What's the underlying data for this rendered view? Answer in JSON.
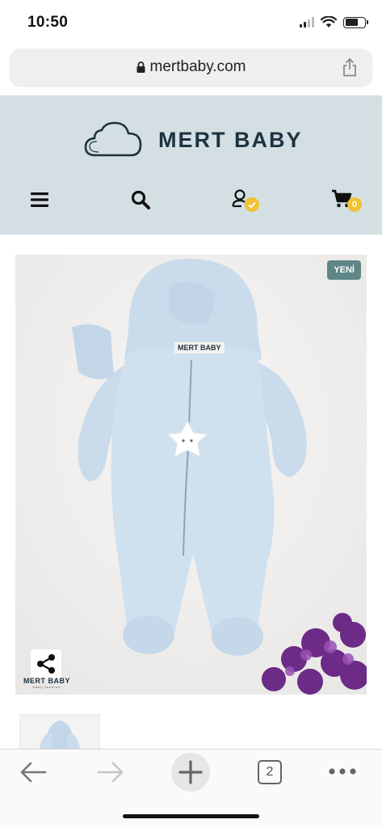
{
  "status_bar": {
    "time": "10:50"
  },
  "browser": {
    "url": "mertbaby.com",
    "tab_count": "2"
  },
  "site": {
    "logo_text": "MERT BABY",
    "cart_count": "0"
  },
  "product": {
    "badge": "YENİ",
    "brand_label": "MERT BABY",
    "watermark": "MERT BABY",
    "watermark_tagline": "baby fashion"
  },
  "colors": {
    "header_bg": "#d3dfe3",
    "logo_text": "#1d3340",
    "badge_yellow": "#f1c232",
    "new_badge": "#5f8686",
    "onesie_blue": "#cfe0ef"
  },
  "icons": {
    "lock": "lock-icon",
    "share": "share-icon",
    "menu": "menu-icon",
    "search": "search-icon",
    "account": "user-icon",
    "cart": "cart-icon",
    "back": "arrow-left-icon",
    "forward": "arrow-right-icon",
    "new_tab": "plus-icon",
    "more": "more-icon"
  }
}
